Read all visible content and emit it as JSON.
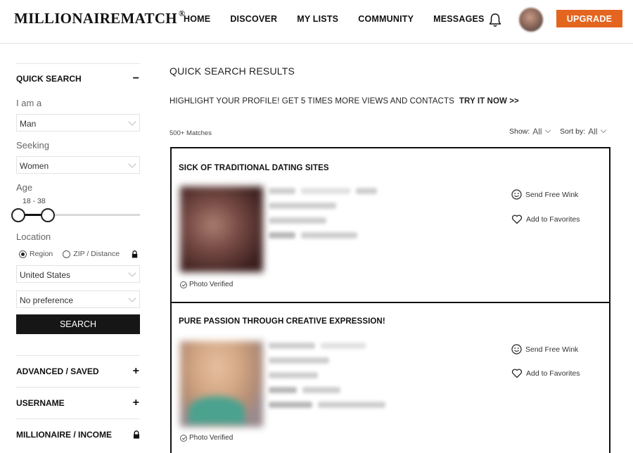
{
  "header": {
    "logo": "MILLIONAIREMATCH",
    "logo_mark": "®",
    "nav": [
      "HOME",
      "DISCOVER",
      "MY LISTS",
      "COMMUNITY",
      "MESSAGES"
    ],
    "upgrade_label": "UPGRADE",
    "icons": {
      "notifications": "bell-icon",
      "profile": "avatar"
    },
    "accent_color": "#e4651f"
  },
  "sidebar": {
    "quick_search": {
      "title": "QUICK SEARCH",
      "toggle": "−"
    },
    "i_am_a": {
      "label": "I am a",
      "value": "Man"
    },
    "seeking": {
      "label": "Seeking",
      "value": "Women"
    },
    "age": {
      "label": "Age",
      "range_text": "18 - 38",
      "min": 18,
      "max": 38
    },
    "location": {
      "label": "Location",
      "option_region": "Region",
      "option_zip": "ZIP / Distance",
      "selected": "Region",
      "country": "United States",
      "preference": "No preference"
    },
    "search_label": "SEARCH",
    "sections": [
      {
        "title": "ADVANCED / SAVED",
        "toggle": "+"
      },
      {
        "title": "USERNAME",
        "toggle": "+"
      },
      {
        "title": "MILLIONAIRE / INCOME",
        "toggle": "lock-icon"
      }
    ]
  },
  "main": {
    "title": "QUICK SEARCH RESULTS",
    "promo_text": "HIGHLIGHT YOUR PROFILE! GET 5 TIMES MORE VIEWS AND CONTACTS",
    "promo_link": "TRY IT NOW >>",
    "matches": "500+ Matches",
    "show_label": "Show:",
    "show_value": "All",
    "sort_label": "Sort by:",
    "sort_value": "All",
    "profiles": [
      {
        "headline": "SICK OF TRADITIONAL DATING SITES",
        "verified": "Photo Verified",
        "wink": "Send Free Wink",
        "favorite": "Add to Favorites"
      },
      {
        "headline": "PURE PASSION THROUGH CREATIVE EXPRESSION!",
        "verified": "Photo Verified",
        "wink": "Send Free Wink",
        "favorite": "Add to Favorites"
      }
    ]
  }
}
